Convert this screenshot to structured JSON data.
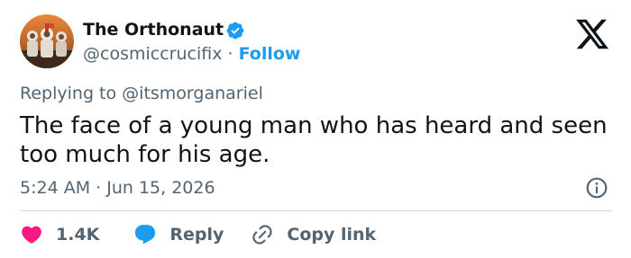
{
  "author": {
    "display_name": "The Orthonaut",
    "handle": "@cosmiccrucifix",
    "separator": "·",
    "follow_label": "Follow",
    "verified": true,
    "avatar_icon": "astronaut-avatar"
  },
  "reply_context": {
    "prefix": "Replying to",
    "mention": "@itsmorganariel"
  },
  "tweet": {
    "text": "The face of a young man who has heard and seen too much for his age.",
    "timestamp": "5:24 AM · Jun 15, 2026"
  },
  "actions": {
    "like_count": "1.4K",
    "reply_label": "Reply",
    "copy_link_label": "Copy link"
  },
  "icons": {
    "brand": "x-logo-icon",
    "verified": "verified-badge-icon",
    "info": "info-icon",
    "like": "heart-icon",
    "reply": "speech-bubble-icon",
    "link": "link-icon"
  },
  "colors": {
    "text_primary": "#0f1419",
    "text_secondary": "#536471",
    "accent_blue": "#1d9bf0",
    "like_red": "#f91880",
    "divider": "#cfd9de"
  }
}
